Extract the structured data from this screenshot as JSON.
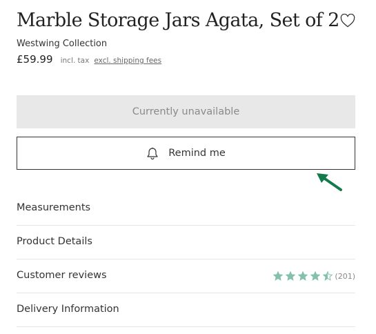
{
  "product": {
    "title": "Marble Storage Jars Agata, Set of 2",
    "brand": "Westwing Collection",
    "price": "£59.99",
    "tax_note": "incl. tax",
    "shipping_link": "excl. shipping fees"
  },
  "actions": {
    "unavailable_label": "Currently unavailable",
    "remind_label": "Remind me"
  },
  "sections": [
    {
      "label": "Measurements"
    },
    {
      "label": "Product Details"
    },
    {
      "label": "Customer reviews"
    },
    {
      "label": "Delivery Information"
    }
  ],
  "reviews": {
    "rating": 4.5,
    "max": 5,
    "count_label": "(201)"
  },
  "colors": {
    "star": "#84c1ad",
    "arrow": "#137a4b",
    "disabled_bg": "#e8e8e8"
  },
  "icons": {
    "wishlist": "heart-icon",
    "remind": "bell-icon",
    "annotation": "arrow-icon",
    "rating": "star-icon"
  }
}
